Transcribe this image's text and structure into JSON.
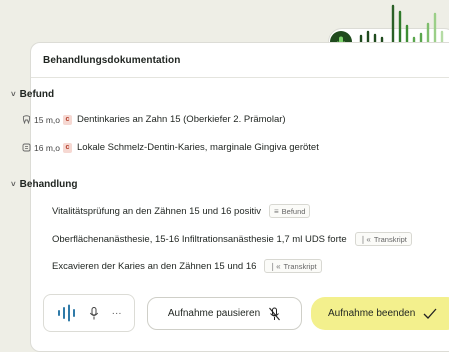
{
  "header": {
    "title": "Behandlungsdokumentation"
  },
  "befund": {
    "title": "Befund",
    "items": [
      {
        "tooth_icon": "tooth-icon",
        "meta": "15 m,o",
        "badge": "c",
        "text": "Dentinkaries an Zahn 15 (Oberkiefer 2. Prämolar)"
      },
      {
        "tooth_icon": "tooth-icon",
        "meta": "16 m,o",
        "badge": "c",
        "text": "Lokale Schmelz-Dentin-Karies, marginale Gingiva gerötet"
      }
    ]
  },
  "behandlung": {
    "title": "Behandlung",
    "items": [
      {
        "text": "Vitalitätsprüfung an den Zähnen 15 und 16 positiv",
        "tag": "Befund",
        "tag_icon": "list-icon"
      },
      {
        "text": "Oberflächenanästhesie, 15-16 Infiltrationsanästhesie 1,7 ml UDS forte",
        "tag": "Transkript",
        "tag_icon": "quote-icon"
      },
      {
        "text": "Excavieren der Karies an den Zähnen 15 und 16",
        "tag": "Transkript",
        "tag_icon": "quote-icon"
      }
    ]
  },
  "controls": {
    "more_label": "···",
    "pause_label": "Aufnahme pausieren",
    "end_label": "Aufnahme beenden"
  },
  "colors": {
    "accent_green": "#2f7a2a",
    "end_button": "#f3f08d",
    "badge": "#f6d8d2"
  }
}
